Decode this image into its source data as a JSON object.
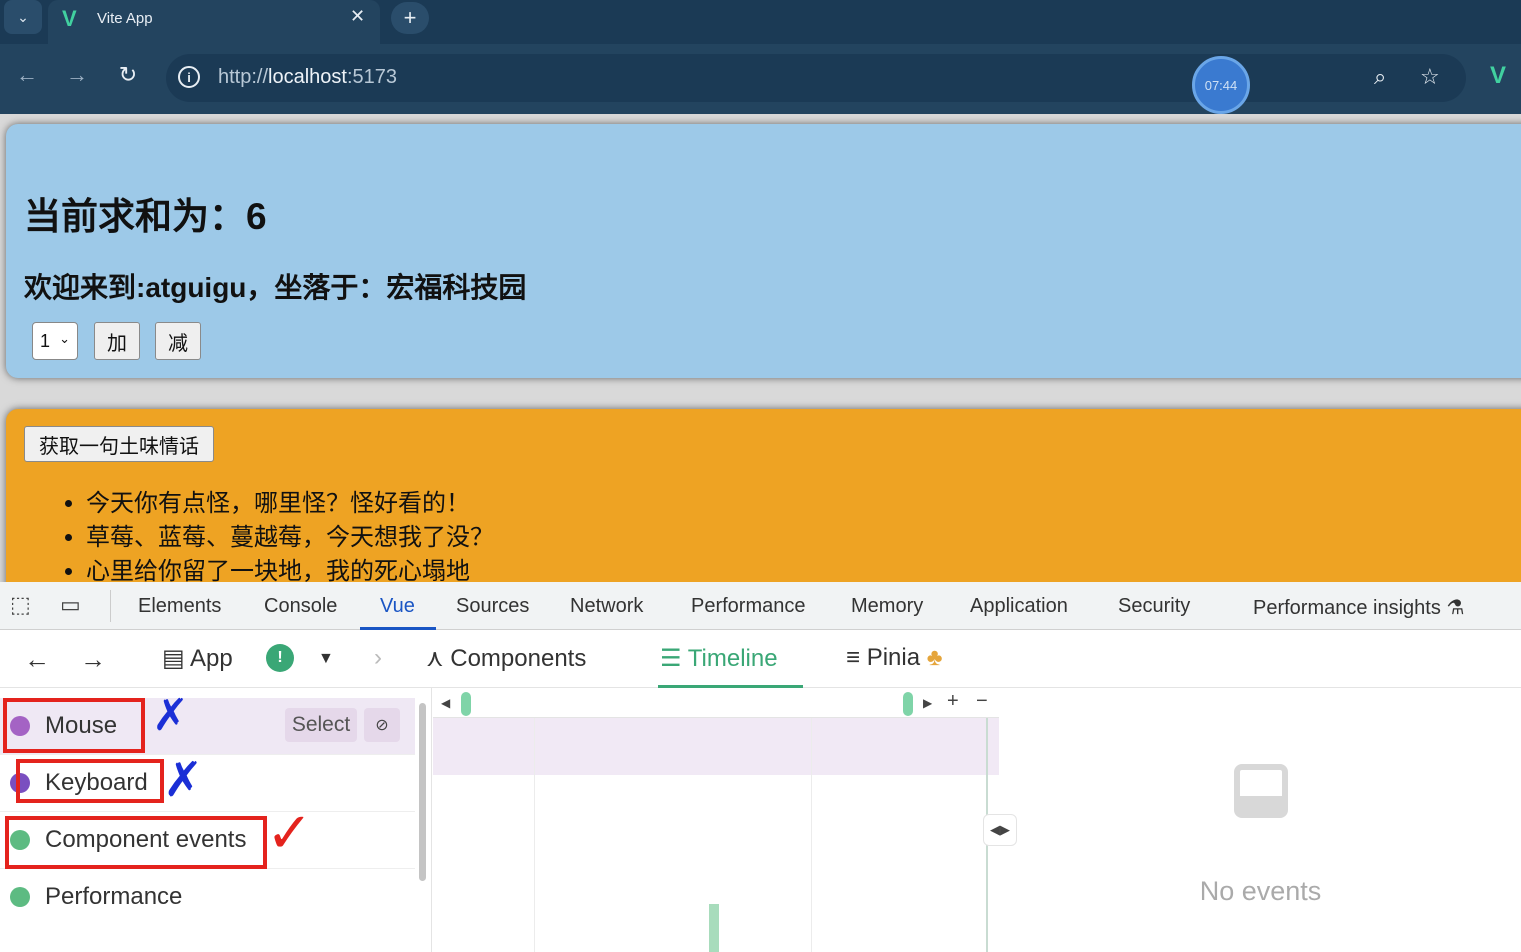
{
  "browser": {
    "tab_title": "Vite App",
    "url_scheme": "http://",
    "url_host": "localhost",
    "url_port": ":5173",
    "timer": "07:44"
  },
  "page": {
    "sum_heading": "当前求和为：6",
    "welcome_heading": "欢迎来到:atguigu，坐落于：宏福科技园",
    "step_select": "1",
    "add_button": "加",
    "subtract_button": "减",
    "get_talk_button": "获取一句土味情话",
    "talks": [
      "今天你有点怪，哪里怪？怪好看的！",
      "草莓、蓝莓、蔓越莓，今天想我了没？",
      "心里给你留了一块地，我的死心塌地"
    ]
  },
  "devtools": {
    "tabs": [
      "Elements",
      "Console",
      "Vue",
      "Sources",
      "Network",
      "Performance",
      "Memory",
      "Application",
      "Security",
      "Performance insights"
    ],
    "active_tab": "Vue",
    "vue_nav": {
      "app_label": "App",
      "components_label": "Components",
      "timeline_label": "Timeline",
      "pinia_label": "Pinia"
    },
    "layers": [
      {
        "label": "Mouse",
        "color": "#a463c4"
      },
      {
        "label": "Keyboard",
        "color": "#7a4fc0"
      },
      {
        "label": "Component events",
        "color": "#5dbb82"
      },
      {
        "label": "Performance",
        "color": "#5dbb82"
      }
    ],
    "select_button": "Select",
    "empty_state": "No events"
  },
  "colors": {
    "blue_panel": "#9dc9e8",
    "orange_panel": "#eea323",
    "vue_green": "#3aa776",
    "annotation_red": "#e4231d",
    "annotation_blue": "#1b2fd6"
  }
}
